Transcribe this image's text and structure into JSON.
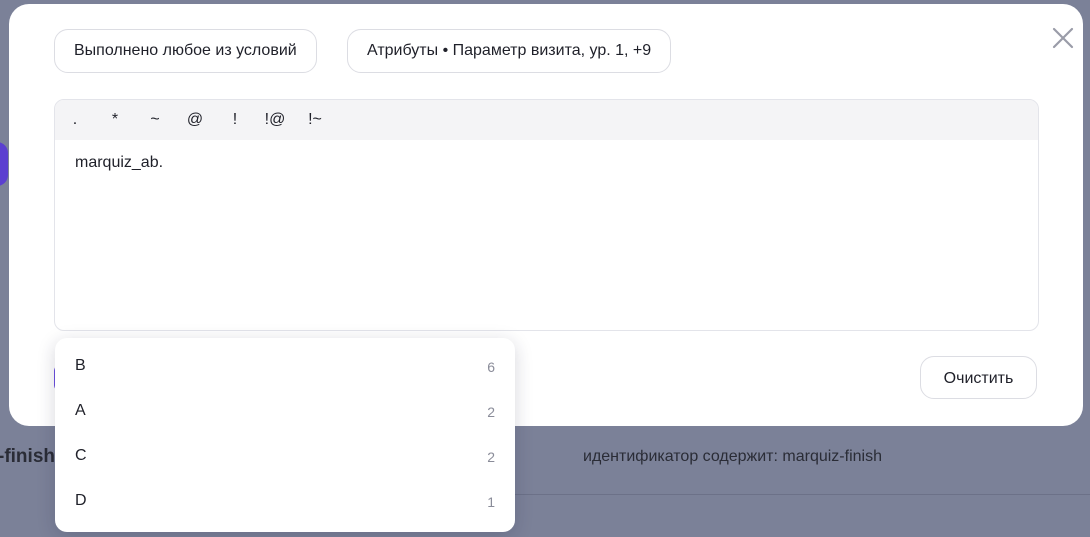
{
  "background": {
    "left_text": "-finish",
    "right_text": "идентификатор содержит: marquiz-finish"
  },
  "modal": {
    "chips": {
      "condition": "Выполнено любое из условий",
      "attributes": "Атрибуты • Параметр визита, ур. 1, +9"
    },
    "close_icon": "close-icon",
    "operators": [
      ".",
      "*",
      "~",
      "@",
      "!",
      "!@",
      "!~"
    ],
    "editor_value": "marquiz_ab.",
    "clear_label": "Очистить"
  },
  "dropdown": {
    "items": [
      {
        "label": "B",
        "count": "6"
      },
      {
        "label": "A",
        "count": "2"
      },
      {
        "label": "C",
        "count": "2"
      },
      {
        "label": "D",
        "count": "1"
      }
    ]
  },
  "colors": {
    "overlay": "#7b8198",
    "accent": "#6c4fe0",
    "text": "#1f2029",
    "muted": "#8a8c99"
  }
}
